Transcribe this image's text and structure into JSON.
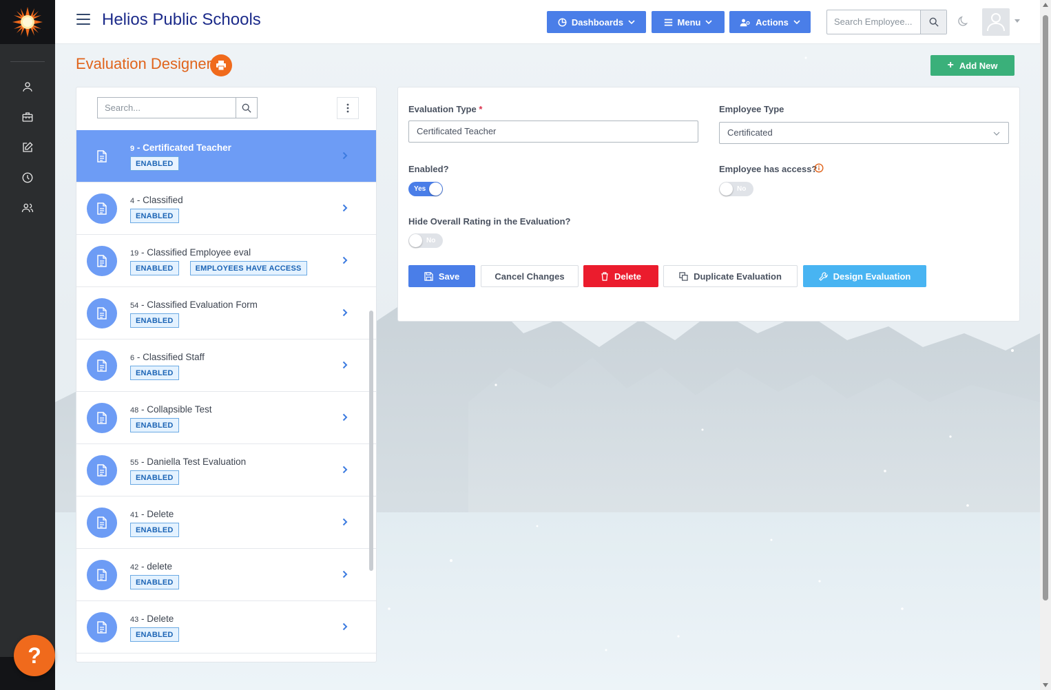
{
  "header": {
    "app_title": "Helios Public Schools",
    "dashboards_label": "Dashboards",
    "menu_label": "Menu",
    "actions_label": "Actions",
    "search_placeholder": "Search Employee..."
  },
  "page": {
    "title": "Evaluation Designer",
    "add_new_label": "Add New",
    "help_label": "?"
  },
  "list": {
    "search_placeholder": "Search...",
    "items": [
      {
        "num": "9",
        "name": "Certificated Teacher",
        "badges": [
          "ENABLED"
        ],
        "active": true
      },
      {
        "num": "4",
        "name": "Classified",
        "badges": [
          "ENABLED"
        ]
      },
      {
        "num": "19",
        "name": "Classified Employee eval",
        "badges": [
          "ENABLED",
          "EMPLOYEES HAVE ACCESS"
        ]
      },
      {
        "num": "54",
        "name": "Classified Evaluation Form",
        "badges": [
          "ENABLED"
        ]
      },
      {
        "num": "6",
        "name": "Classified Staff",
        "badges": [
          "ENABLED"
        ]
      },
      {
        "num": "48",
        "name": "Collapsible Test",
        "badges": [
          "ENABLED"
        ]
      },
      {
        "num": "55",
        "name": "Daniella Test Evaluation",
        "badges": [
          "ENABLED"
        ]
      },
      {
        "num": "41",
        "name": "Delete",
        "badges": [
          "ENABLED"
        ]
      },
      {
        "num": "42",
        "name": "delete",
        "badges": [
          "ENABLED"
        ]
      },
      {
        "num": "43",
        "name": "Delete",
        "badges": [
          "ENABLED"
        ]
      }
    ]
  },
  "form": {
    "eval_type_label": "Evaluation Type",
    "eval_type_required": "*",
    "eval_type_value": "Certificated Teacher",
    "emp_type_label": "Employee Type",
    "emp_type_value": "Certificated",
    "enabled_label": "Enabled?",
    "enabled_value": "Yes",
    "emp_access_label": "Employee has access?",
    "emp_access_value": "No",
    "hide_rating_label": "Hide Overall Rating in the Evaluation?",
    "hide_rating_value": "No",
    "save_label": "Save",
    "cancel_label": "Cancel Changes",
    "delete_label": "Delete",
    "duplicate_label": "Duplicate Evaluation",
    "design_label": "Design Evaluation"
  },
  "colors": {
    "brand_blue": "#4a7ee8",
    "title_orange": "#e0641c",
    "add_green": "#3ab07a",
    "delete_red": "#eb1c2d",
    "design_cyan": "#48b4f2",
    "active_item": "#6d9cf5"
  }
}
